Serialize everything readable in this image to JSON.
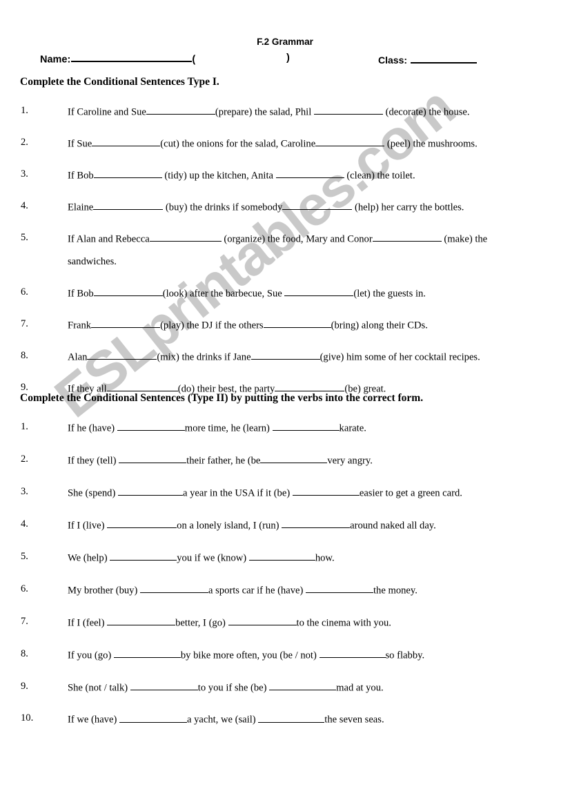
{
  "header": {
    "title": "F.2 Grammar",
    "name_label": "Name:",
    "name_rule_width": 175,
    "paren_open": "(",
    "paren_close": ")",
    "class_label": "Class:"
  },
  "sections": [
    {
      "heading": "Complete the Conditional Sentences Type I.",
      "items": [
        {
          "number": "1.",
          "parts": [
            {
              "text": "If Caroline and Sue"
            },
            {
              "blank": 100
            },
            {
              "text": "(prepare) the salad, Phil "
            },
            {
              "blank": 100
            },
            {
              "text": " (decorate) the house."
            }
          ]
        },
        {
          "number": "2.",
          "parts": [
            {
              "text": "If Sue"
            },
            {
              "blank": 99
            },
            {
              "text": "(cut) the onions for the salad, Caroline"
            },
            {
              "blank": 100
            },
            {
              "text": " (peel) the mushrooms."
            }
          ]
        },
        {
          "number": "3.",
          "parts": [
            {
              "text": "If Bob"
            },
            {
              "blank": 99
            },
            {
              "text": " (tidy) up the kitchen, Anita "
            },
            {
              "blank": 99
            },
            {
              "text": " (clean) the toilet."
            }
          ]
        },
        {
          "number": "4.",
          "parts": [
            {
              "text": "Elaine"
            },
            {
              "blank": 101
            },
            {
              "text": " (buy) the drinks if somebody"
            },
            {
              "blank": 101
            },
            {
              "text": " (help) her carry the bottles."
            }
          ]
        },
        {
          "number": "5.",
          "parts": [
            {
              "text": "If Alan and Rebecca"
            },
            {
              "blank": 104
            },
            {
              "text": " (organize) the food, Mary and Conor"
            },
            {
              "blank": 100
            },
            {
              "text": " (make) the"
            }
          ],
          "continuation": "sandwiches."
        },
        {
          "number": "6.",
          "parts": [
            {
              "text": "If Bob"
            },
            {
              "blank": 100
            },
            {
              "text": "(look) after the barbecue, Sue "
            },
            {
              "blank": 100
            },
            {
              "text": "(let) the guests in."
            }
          ]
        },
        {
          "number": "7.",
          "parts": [
            {
              "text": "Frank"
            },
            {
              "blank": 100
            },
            {
              "text": "(play) the DJ if the others"
            },
            {
              "blank": 98
            },
            {
              "text": "(bring) along their CDs."
            }
          ]
        },
        {
          "number": "8.",
          "parts": [
            {
              "text": "Alan"
            },
            {
              "blank": 101
            },
            {
              "text": "(mix) the drinks if Jane"
            },
            {
              "blank": 100
            },
            {
              "text": "(give) him some of her cocktail recipes."
            }
          ]
        },
        {
          "number": "9.",
          "parts": [
            {
              "text": "If they all"
            },
            {
              "blank": 103
            },
            {
              "text": "(do) their best, the party"
            },
            {
              "blank": 101
            },
            {
              "text": "(be) great."
            }
          ]
        }
      ]
    },
    {
      "heading": "Complete the Conditional Sentences (Type II) by putting the verbs into the correct form.",
      "items": [
        {
          "number": "1.",
          "parts": [
            {
              "text": "If he (have) "
            },
            {
              "blank": 98
            },
            {
              "text": "more time, he (learn) "
            },
            {
              "blank": 97
            },
            {
              "text": "karate."
            }
          ]
        },
        {
          "number": "2.",
          "parts": [
            {
              "text": "If they (tell) "
            },
            {
              "blank": 98
            },
            {
              "text": "their father, he (be"
            },
            {
              "blank": 97
            },
            {
              "text": "very angry."
            }
          ]
        },
        {
          "number": "3.",
          "parts": [
            {
              "text": "She (spend) "
            },
            {
              "blank": 94
            },
            {
              "text": "a year in the USA if it (be) "
            },
            {
              "blank": 97
            },
            {
              "text": "easier to get a green card."
            }
          ]
        },
        {
          "number": "4.",
          "parts": [
            {
              "text": "If I (live) "
            },
            {
              "blank": 101
            },
            {
              "text": "on a lonely island, I (run) "
            },
            {
              "blank": 99
            },
            {
              "text": "around naked all day."
            }
          ]
        },
        {
          "number": "5.",
          "parts": [
            {
              "text": "We (help) "
            },
            {
              "blank": 97
            },
            {
              "text": "you if we (know) "
            },
            {
              "blank": 96
            },
            {
              "text": "how."
            }
          ]
        },
        {
          "number": "6.",
          "parts": [
            {
              "text": "My brother (buy) "
            },
            {
              "blank": 99
            },
            {
              "text": "a sports car if he (have) "
            },
            {
              "blank": 98
            },
            {
              "text": "the money."
            }
          ]
        },
        {
          "number": "7.",
          "parts": [
            {
              "text": "If I (feel) "
            },
            {
              "blank": 99
            },
            {
              "text": "better, I (go) "
            },
            {
              "blank": 99
            },
            {
              "text": "to the cinema with you."
            }
          ]
        },
        {
          "number": "8.",
          "parts": [
            {
              "text": "If you (go) "
            },
            {
              "blank": 97
            },
            {
              "text": "by bike more often, you (be / not) "
            },
            {
              "blank": 96
            },
            {
              "text": "so flabby."
            }
          ]
        },
        {
          "number": "9.",
          "parts": [
            {
              "text": "She (not / talk) "
            },
            {
              "blank": 98
            },
            {
              "text": "to you if she (be) "
            },
            {
              "blank": 97
            },
            {
              "text": "mad at you."
            }
          ]
        },
        {
          "number": "10.",
          "parts": [
            {
              "text": "If we (have) "
            },
            {
              "blank": 98
            },
            {
              "text": "a yacht, we (sail) "
            },
            {
              "blank": 96
            },
            {
              "text": "the seven seas."
            }
          ]
        }
      ]
    }
  ],
  "watermark": {
    "text": "ESLprintables.com",
    "color": "#c9c9c9"
  },
  "colors": {
    "text": "#000000",
    "page_background": "#ffffff",
    "rule": "#000000"
  }
}
